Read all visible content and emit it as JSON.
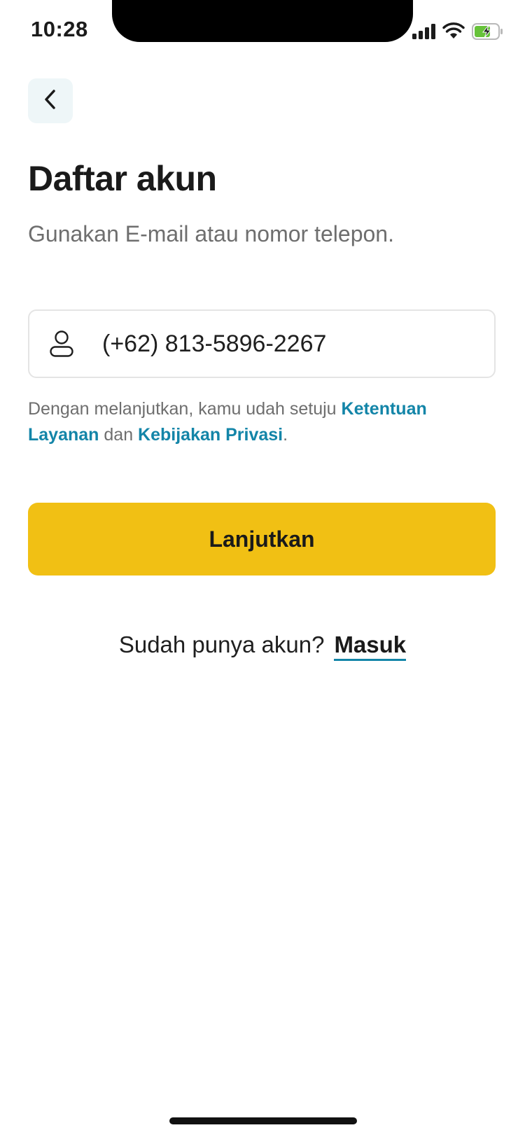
{
  "status_bar": {
    "time": "10:28",
    "icons": [
      "signal-icon",
      "wifi-icon",
      "battery-icon"
    ]
  },
  "header": {
    "back_icon": "chevron-left-icon",
    "title": "Daftar akun",
    "subtitle": "Gunakan E-mail atau nomor telepon."
  },
  "form": {
    "input_icon": "user-icon",
    "phone_value": "(+62) 813-5896-2267"
  },
  "terms": {
    "prefix": "Dengan melanjutkan, kamu udah setuju ",
    "terms_link": "Ketentuan Layanan",
    "connector": " dan ",
    "privacy_link": "Kebijakan Privasi",
    "suffix": "."
  },
  "actions": {
    "continue_label": "Lanjutkan"
  },
  "login": {
    "prompt": "Sudah punya akun?",
    "link": "Masuk"
  },
  "colors": {
    "accent": "#f1c014",
    "link": "#1385a8",
    "back_button_bg": "#eef6f8",
    "text_primary": "#1a1a1a",
    "text_secondary": "#6e6e6e"
  }
}
